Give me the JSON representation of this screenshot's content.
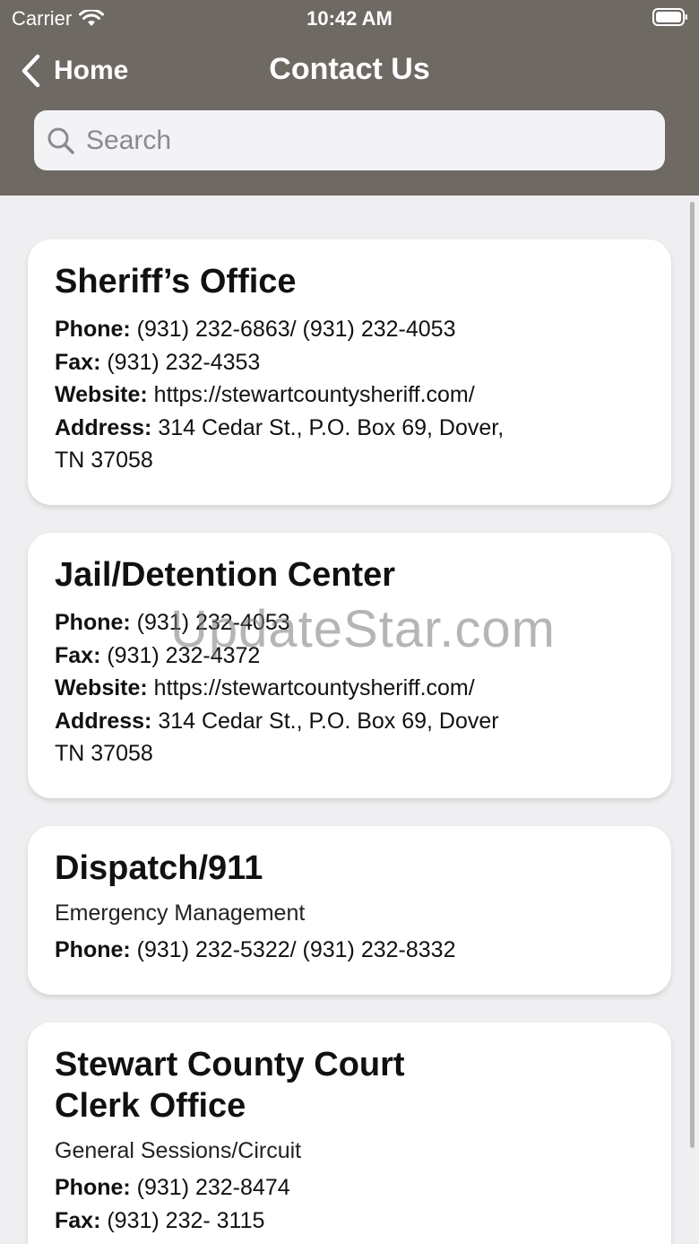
{
  "status_bar": {
    "carrier": "Carrier",
    "time": "10:42 AM"
  },
  "nav": {
    "back_label": "Home",
    "title": "Contact Us"
  },
  "search": {
    "placeholder": "Search"
  },
  "cards": [
    {
      "title": "Sheriff’s Office",
      "lines": [
        {
          "label": "Phone:",
          "value": " (931) 232-6863/ (931) 232-4053"
        },
        {
          "label": "Fax:",
          "value": " (931) 232-4353"
        },
        {
          "label": "Website:",
          "value": " https://stewartcountysheriff.com/"
        },
        {
          "label": "Address:",
          "value": " 314 Cedar St., P.O. Box 69, Dover,"
        },
        {
          "label": "",
          "value": "TN 37058"
        }
      ]
    },
    {
      "title": "Jail/Detention Center",
      "lines": [
        {
          "label": "Phone:",
          "value": " (931) 232-4053"
        },
        {
          "label": "Fax:",
          "value": " (931) 232-4372"
        },
        {
          "label": "Website:",
          "value": " https://stewartcountysheriff.com/"
        },
        {
          "label": "Address:",
          "value": " 314 Cedar St., P.O. Box 69, Dover"
        },
        {
          "label": "",
          "value": "TN 37058"
        }
      ]
    },
    {
      "title": "Dispatch/911",
      "subtitle": "Emergency Management",
      "lines": [
        {
          "label": "Phone:",
          "value": " (931) 232-5322/ (931) 232-8332"
        }
      ]
    },
    {
      "title": "Stewart County Court\nClerk Office",
      "subtitle": "General Sessions/Circuit",
      "lines": [
        {
          "label": "Phone:",
          "value": " (931) 232-8474"
        },
        {
          "label": "Fax:",
          "value": " (931) 232- 3115"
        }
      ]
    }
  ],
  "watermark": "UpdateStar.com"
}
